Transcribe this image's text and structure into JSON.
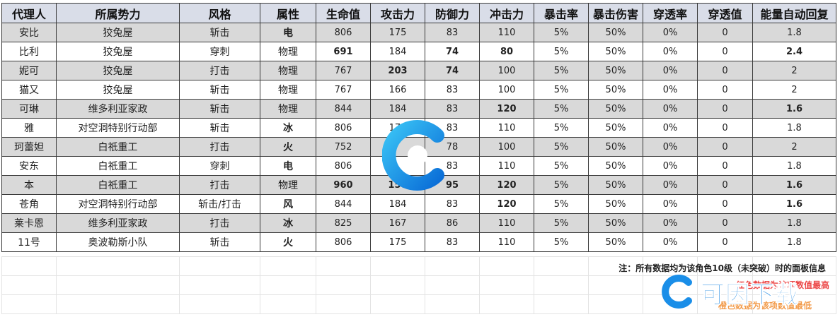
{
  "headers": [
    "代理人",
    "所属势力",
    "风格",
    "属性",
    "生命值",
    "攻击力",
    "防御力",
    "冲击力",
    "暴击率",
    "暴击伤害",
    "穿透率",
    "穿透值",
    "能量自动回复"
  ],
  "rows": [
    {
      "cells": [
        "安比",
        "狡兔屋",
        "斩击",
        "电",
        "806",
        "175",
        "83",
        "110",
        "5%",
        "50%",
        "0%",
        "0",
        "1.8"
      ],
      "styles": [
        "",
        "",
        "",
        "c-purple",
        "",
        "",
        "",
        "",
        "",
        "",
        "",
        "",
        ""
      ]
    },
    {
      "cells": [
        "比利",
        "狡兔屋",
        "穿刺",
        "物理",
        "691",
        "184",
        "74",
        "80",
        "5%",
        "50%",
        "0%",
        "0",
        "2.4"
      ],
      "styles": [
        "",
        "",
        "",
        "c-gray",
        "c-orange",
        "",
        "c-orange",
        "c-orange",
        "",
        "",
        "",
        "",
        "c-red"
      ]
    },
    {
      "cells": [
        "妮可",
        "狡兔屋",
        "打击",
        "物理",
        "767",
        "203",
        "74",
        "100",
        "5%",
        "50%",
        "0%",
        "0",
        "2"
      ],
      "styles": [
        "",
        "",
        "",
        "c-gray",
        "",
        "c-red",
        "c-orange",
        "",
        "",
        "",
        "",
        "",
        ""
      ]
    },
    {
      "cells": [
        "猫又",
        "狡兔屋",
        "斩击",
        "物理",
        "767",
        "166",
        "83",
        "100",
        "5%",
        "50%",
        "0%",
        "0",
        "2"
      ],
      "styles": [
        "",
        "",
        "",
        "c-gray",
        "",
        "",
        "",
        "",
        "",
        "",
        "",
        "",
        ""
      ]
    },
    {
      "cells": [
        "可琳",
        "维多利亚家政",
        "斩击",
        "物理",
        "844",
        "184",
        "83",
        "120",
        "5%",
        "50%",
        "0%",
        "0",
        "1.6"
      ],
      "styles": [
        "",
        "",
        "",
        "c-gray",
        "",
        "",
        "",
        "c-red",
        "",
        "",
        "",
        "",
        "c-orange"
      ]
    },
    {
      "cells": [
        "雅",
        "对空洞特别行动部",
        "斩击",
        "冰",
        "806",
        "175",
        "83",
        "110",
        "5%",
        "50%",
        "0%",
        "0",
        "1.8"
      ],
      "styles": [
        "",
        "",
        "",
        "c-cyan",
        "",
        "",
        "",
        "",
        "",
        "",
        "",
        "",
        ""
      ]
    },
    {
      "cells": [
        "珂蕾妲",
        "白祇重工",
        "打击",
        "火",
        "752",
        "",
        "78",
        "100",
        "5%",
        "50%",
        "0%",
        "0",
        "2"
      ],
      "styles": [
        "",
        "",
        "",
        "c-red",
        "",
        "",
        "",
        "",
        "",
        "",
        "",
        "",
        ""
      ]
    },
    {
      "cells": [
        "安东",
        "白祇重工",
        "穿刺",
        "电",
        "806",
        "",
        "83",
        "110",
        "5%",
        "50%",
        "0%",
        "0",
        "1.8"
      ],
      "styles": [
        "",
        "",
        "",
        "c-purple",
        "",
        "",
        "",
        "",
        "",
        "",
        "",
        "",
        ""
      ]
    },
    {
      "cells": [
        "本",
        "白祇重工",
        "打击",
        "物理",
        "960",
        "158",
        "95",
        "120",
        "5%",
        "50%",
        "0%",
        "0",
        "1.6"
      ],
      "styles": [
        "",
        "",
        "",
        "c-gray",
        "c-red",
        "c-orange",
        "c-red",
        "c-red",
        "",
        "",
        "",
        "",
        "c-orange"
      ]
    },
    {
      "cells": [
        "苍角",
        "对空洞特别行动部",
        "斩击/打击",
        "风",
        "844",
        "184",
        "83",
        "120",
        "5%",
        "50%",
        "0%",
        "0",
        "1.6"
      ],
      "styles": [
        "",
        "",
        "",
        "c-green",
        "",
        "",
        "",
        "c-red",
        "",
        "",
        "",
        "",
        "c-orange"
      ]
    },
    {
      "cells": [
        "莱卡恩",
        "维多利亚家政",
        "打击",
        "冰",
        "825",
        "167",
        "86",
        "110",
        "5%",
        "50%",
        "0%",
        "0",
        "1.8"
      ],
      "styles": [
        "",
        "",
        "",
        "c-cyan",
        "",
        "",
        "",
        "",
        "",
        "",
        "",
        "",
        ""
      ]
    },
    {
      "cells": [
        "11号",
        "奥波勒斯小队",
        "斩击",
        "火",
        "806",
        "175",
        "83",
        "110",
        "5%",
        "50%",
        "0%",
        "0",
        "1.8"
      ],
      "styles": [
        "",
        "",
        "",
        "c-red",
        "",
        "",
        "",
        "",
        "",
        "",
        "",
        "",
        ""
      ]
    }
  ],
  "note": "注：所有数据均为该角色10级（未突破）时的面板信息",
  "legend_red": "红色数据为该项数值最高",
  "legend_orange": "橙色数据为该项数值最低",
  "watermark_text": "可因下载",
  "colors": {
    "red": "#e81818",
    "orange": "#f08a2b",
    "physical_gray": "#888888",
    "electric_purple": "#7c2fa8",
    "ice_cyan": "#1aa8d9",
    "wind_green": "#3cb043",
    "header_bg": "#d9dde8",
    "shaded_row_bg": "#d9d9d9",
    "watermark_blue": "#0d7fe0"
  },
  "icons": [
    "watermark-logo-icon",
    "watermark-logo-small-icon"
  ]
}
